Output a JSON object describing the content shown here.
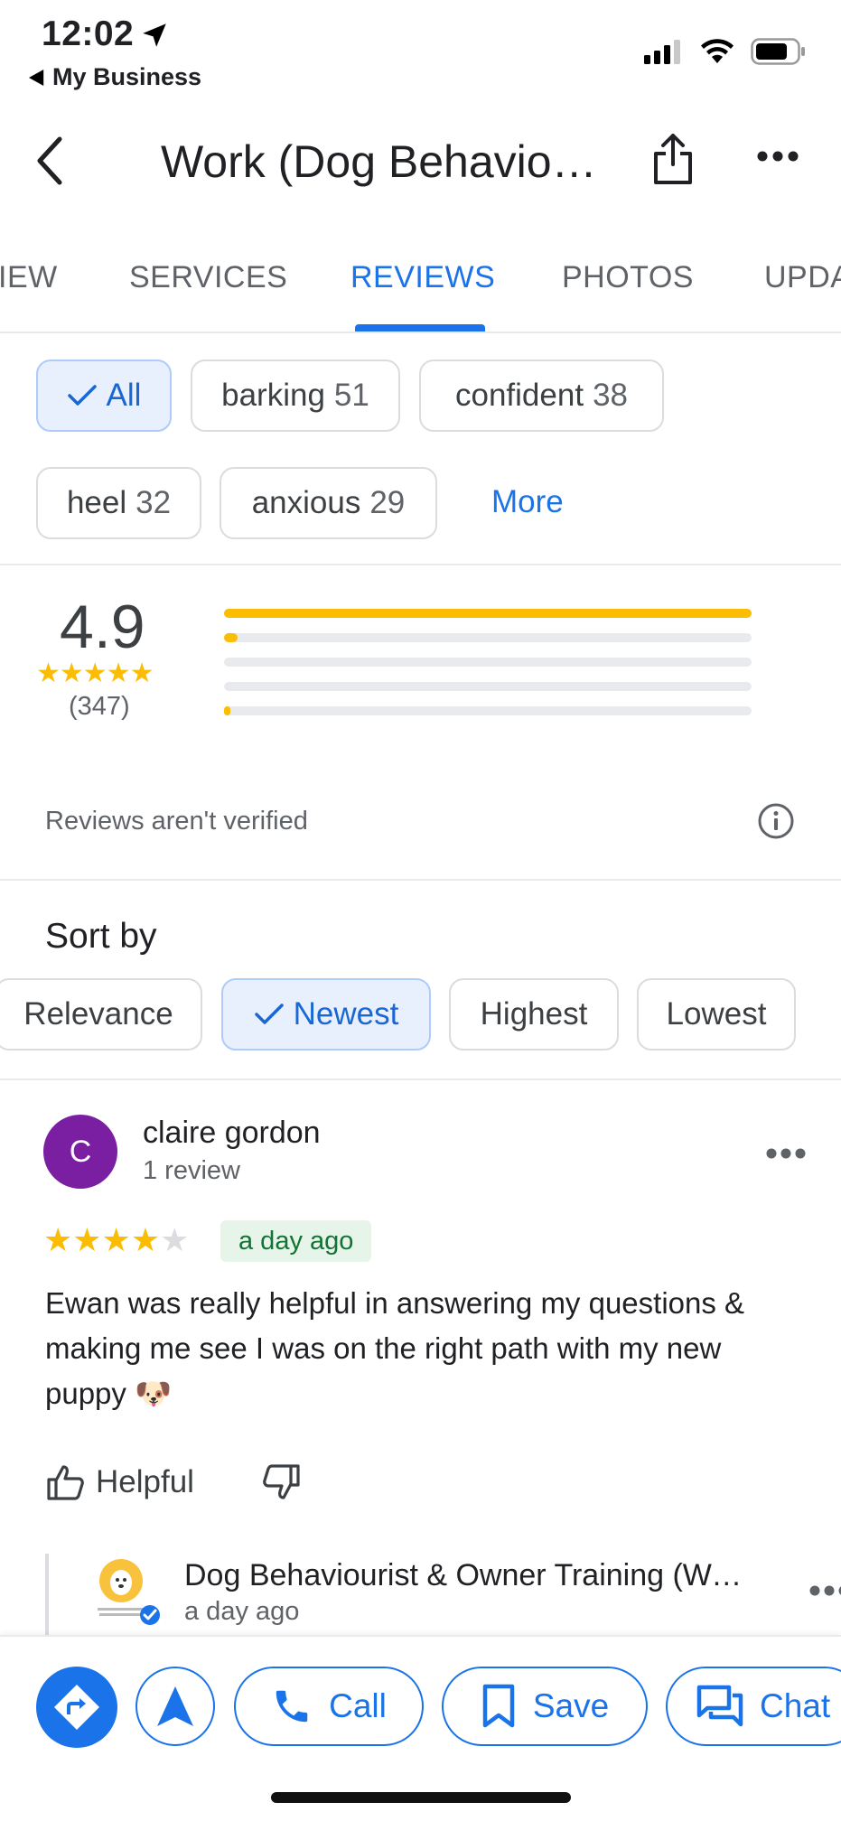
{
  "status_bar": {
    "time": "12:02",
    "back_app": "My Business"
  },
  "header": {
    "title": "Work (Dog Behaviourist & Owner Training)"
  },
  "tabs": [
    {
      "label": "OVERVIEW",
      "shown": "IEW"
    },
    {
      "label": "SERVICES",
      "shown": "SERVICES"
    },
    {
      "label": "REVIEWS",
      "shown": "REVIEWS",
      "active": true
    },
    {
      "label": "PHOTOS",
      "shown": "PHOTOS"
    },
    {
      "label": "UPDATES",
      "shown": "UPDA"
    }
  ],
  "filters": {
    "all_label": "All",
    "topics": [
      {
        "label": "barking",
        "count": "51"
      },
      {
        "label": "confident",
        "count": "38"
      },
      {
        "label": "heel",
        "count": "32"
      },
      {
        "label": "anxious",
        "count": "29"
      }
    ],
    "more_label": "More"
  },
  "rating": {
    "value": "4.9",
    "stars": "★★★★★",
    "count": "(347)",
    "distribution": [
      {
        "stars": 5,
        "fraction": 1.0
      },
      {
        "stars": 4,
        "fraction": 0.025
      },
      {
        "stars": 3,
        "fraction": 0.0
      },
      {
        "stars": 2,
        "fraction": 0.0
      },
      {
        "stars": 1,
        "fraction": 0.012
      }
    ]
  },
  "notice": "Reviews aren't verified",
  "sort": {
    "title": "Sort by",
    "options": [
      "Relevance",
      "Newest",
      "Highest",
      "Lowest"
    ],
    "selected": "Newest"
  },
  "review": {
    "avatar_letter": "C",
    "avatar_color": "#7b1fa2",
    "author": "claire gordon",
    "author_meta": "1 review",
    "stars_on": "★★★★",
    "stars_off": "★",
    "rating": 4,
    "time": "a day ago",
    "text": "Ewan was really helpful in answering my questions & making me see I was on the right path with my new puppy 🐶",
    "helpful_label": "Helpful"
  },
  "owner_reply": {
    "name": "Dog Behaviourist & Owner Training (Work)",
    "time": "a day ago"
  },
  "actions": {
    "call": "Call",
    "save": "Save",
    "chat": "Chat"
  },
  "colors": {
    "accent": "#1a73e8",
    "star": "#fbbc04",
    "badge_bg": "#e6f4ea",
    "badge_text": "#137333"
  }
}
